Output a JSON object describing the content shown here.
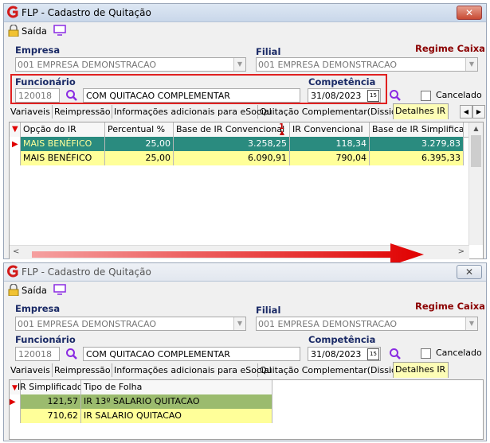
{
  "top": {
    "title": "FLP - Cadastro de Quitação",
    "close": "✕",
    "toolbar": {
      "saida": "Saída"
    },
    "empresa_label": "Empresa",
    "empresa_value": "001 EMPRESA DEMONSTRACAO",
    "filial_label": "Filial",
    "filial_value": "001 EMPRESA DEMONSTRACAO",
    "regime": "Regime Caixa",
    "funcionario_label": "Funcionário",
    "funcionario_code": "120018",
    "funcionario_name": "COM QUITACAO COMPLEMENTAR",
    "competencia_label": "Competência",
    "competencia_value": "31/08/2023",
    "cal": "15",
    "cancelado": "Cancelado",
    "tabs": [
      "Variaveis",
      "Reimpressão",
      "Informações adicionais para eSocial",
      "Quitação Complementar(Dissidio)",
      "Detalhes IR"
    ],
    "columns": [
      "Opção do IR",
      "Percentual %",
      "Base de IR Convencional",
      "IR Convencional",
      "Base de IR Simplificado"
    ],
    "sort_badge": "1",
    "rows": [
      [
        "MAIS BENÉFICO",
        "25,00",
        "3.258,25",
        "118,34",
        "3.279,83"
      ],
      [
        "MAIS BENÉFICO",
        "25,00",
        "6.090,91",
        "790,04",
        "6.395,33"
      ]
    ]
  },
  "bottom": {
    "title": "FLP - Cadastro de Quitação",
    "close": "✕",
    "toolbar": {
      "saida": "Saída"
    },
    "empresa_label": "Empresa",
    "empresa_value": "001 EMPRESA DEMONSTRACAO",
    "filial_label": "Filial",
    "filial_value": "001 EMPRESA DEMONSTRACAO",
    "regime": "Regime Caixa",
    "funcionario_label": "Funcionário",
    "funcionario_code": "120018",
    "funcionario_name": "COM QUITACAO COMPLEMENTAR",
    "competencia_label": "Competência",
    "competencia_value": "31/08/2023",
    "cal": "15",
    "cancelado": "Cancelado",
    "tabs": [
      "Variaveis",
      "Reimpressão",
      "Informações adicionais para eSocial",
      "Quitação Complementar(Dissidio)",
      "Detalhes IR"
    ],
    "columns": [
      "IR Simplificado",
      "Tipo de Folha"
    ],
    "rows": [
      [
        "121,57",
        "IR 13º SALARIO QUITACAO"
      ],
      [
        "710,62",
        "IR SALARIO QUITACAO"
      ]
    ]
  },
  "colors": {
    "selected_row": "#2a8b7f",
    "yellow_row": "#ffff99",
    "green_row": "#9bbb6e",
    "highlight_box": "#e02020",
    "arrow": "#e00000"
  }
}
